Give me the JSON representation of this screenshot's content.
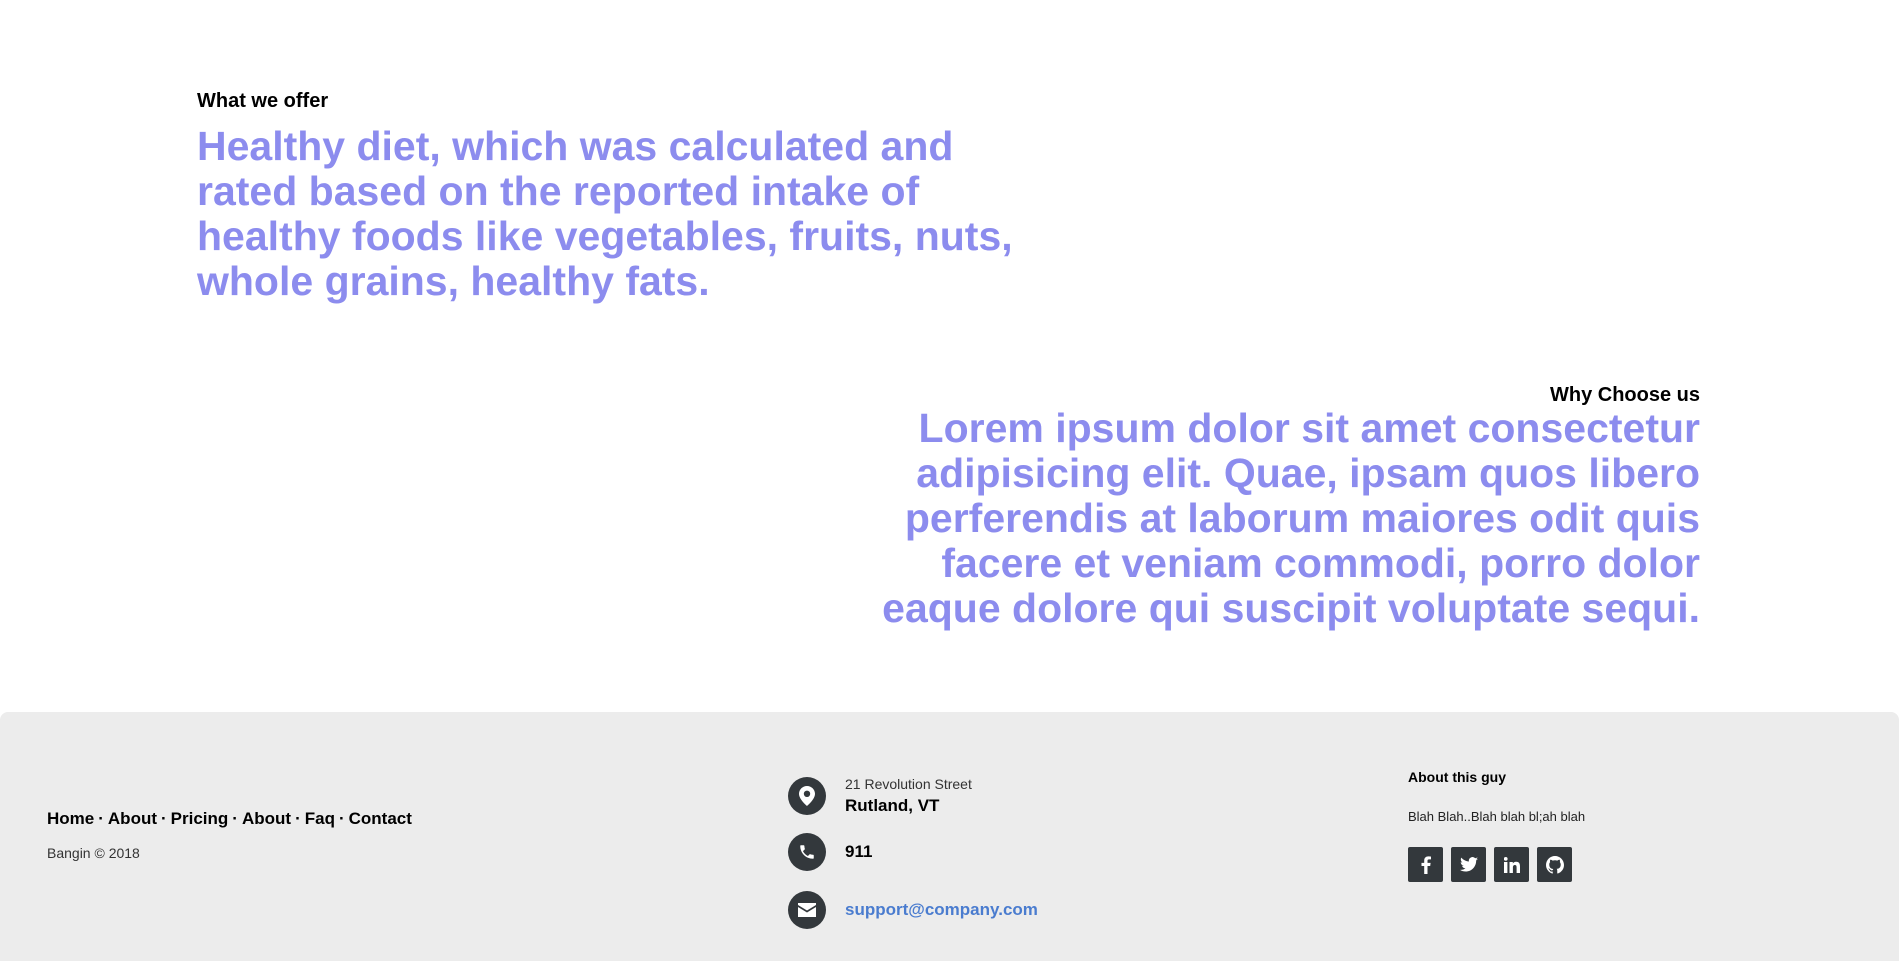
{
  "offer": {
    "label": "What we offer",
    "text": "Healthy diet, which was calculated and rated based on the reported intake of healthy foods like vegetables, fruits, nuts, whole grains, healthy fats."
  },
  "why": {
    "label": "Why Choose us",
    "text": "Lorem ipsum dolor sit amet consectetur adipisicing elit. Quae, ipsam quos libero perferendis at laborum maiores odit quis facere et veniam commodi, porro dolor eaque dolore qui suscipit voluptate sequi."
  },
  "footer": {
    "links": [
      "Home",
      "About",
      "Pricing",
      "About",
      "Faq",
      "Contact"
    ],
    "separator": "·",
    "copyright": "Bangin © 2018",
    "address": {
      "street": "21 Revolution Street",
      "city": "Rutland, VT"
    },
    "phone": "911",
    "email": "support@company.com",
    "about": {
      "title": "About this guy",
      "text": "Blah Blah..Blah blah bl;ah blah"
    },
    "socials": [
      "facebook-icon",
      "twitter-icon",
      "linkedin-icon",
      "github-icon"
    ],
    "colors": {
      "background": "#ececec",
      "icon_bg": "#33383c",
      "email": "#4a7ccf",
      "accent_text": "#8c8cee"
    }
  }
}
